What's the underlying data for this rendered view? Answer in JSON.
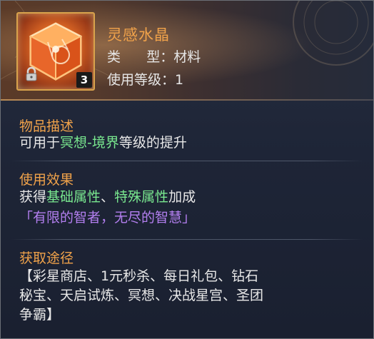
{
  "item": {
    "name": "灵感水晶",
    "type_label": "类      型：",
    "type_value": "材料",
    "level_label": "使用等级：",
    "level_value": "1",
    "count": "3",
    "icon": "orange-crystal-cube-icon",
    "lock_icon": "lock-icon"
  },
  "description": {
    "title": "物品描述",
    "prefix": "可用于",
    "highlight": "冥想-境界",
    "suffix": "等级的提升"
  },
  "effect": {
    "title": "使用效果",
    "prefix": "获得",
    "highlight1": "基础属性",
    "sep": "、",
    "highlight2": "特殊属性",
    "suffix": "加成",
    "quote": "「有限的智者，无尽的智慧」"
  },
  "source": {
    "title": "获取途径",
    "line1": "【彩星商店、1元秒杀、每日礼包、钻石",
    "line2": "秘宝、天启试炼、冥想、决战星宫、圣团",
    "line3": "争霸】"
  },
  "colors": {
    "title_orange": "#f0a24a",
    "highlight_green": "#79e88f",
    "quote_purple": "#b37ff0",
    "text": "#e8e8e8"
  }
}
